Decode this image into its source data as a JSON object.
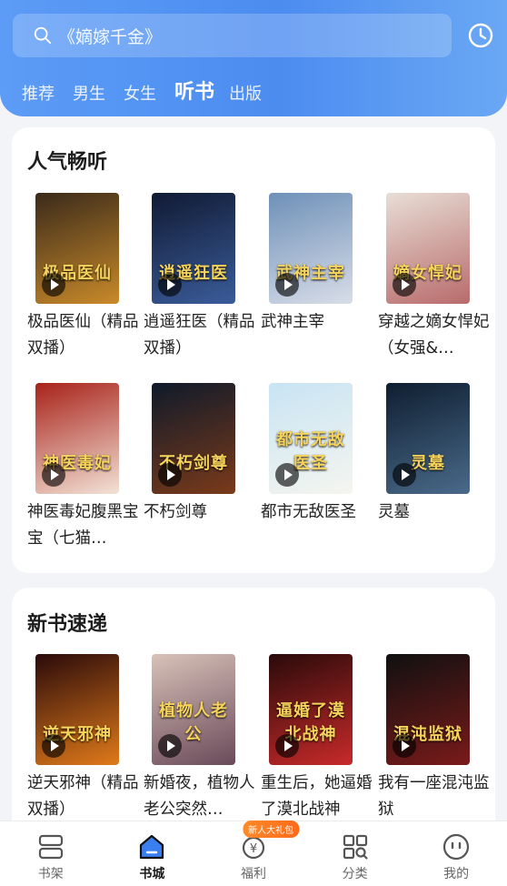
{
  "header": {
    "search_placeholder": "《嫡嫁千金》",
    "tabs": [
      {
        "label": "推荐",
        "active": false
      },
      {
        "label": "男生",
        "active": false
      },
      {
        "label": "女生",
        "active": false
      },
      {
        "label": "听书",
        "active": true
      },
      {
        "label": "出版",
        "active": false
      }
    ],
    "accent": "#4c8cf0"
  },
  "sections": [
    {
      "title": "人气畅听",
      "books": [
        {
          "title": "极品医仙（精品双播）",
          "cover_text": "极品医仙",
          "cover_colors": [
            "#3a2a1a",
            "#c98a2a"
          ]
        },
        {
          "title": "逍遥狂医（精品双播）",
          "cover_text": "逍遥狂医",
          "cover_colors": [
            "#101a33",
            "#3b5c9a"
          ]
        },
        {
          "title": "武神主宰",
          "cover_text": "武神主宰",
          "cover_colors": [
            "#6e90b8",
            "#d8dde8"
          ]
        },
        {
          "title": "穿越之嫡女悍妃（女强&…",
          "cover_text": "嫡女悍妃",
          "cover_colors": [
            "#e8ded6",
            "#b86b6b"
          ]
        },
        {
          "title": "神医毒妃腹黑宝宝（七猫…",
          "cover_text": "神医毒妃",
          "cover_colors": [
            "#a8221a",
            "#f3e2d6"
          ]
        },
        {
          "title": "不朽剑尊",
          "cover_text": "不朽剑尊",
          "cover_colors": [
            "#0f1a2a",
            "#7a3a1a"
          ]
        },
        {
          "title": "都市无敌医圣",
          "cover_text": "都市无敌医圣",
          "cover_colors": [
            "#c8e4f4",
            "#f5f5ef"
          ]
        },
        {
          "title": "灵墓",
          "cover_text": "灵墓",
          "cover_colors": [
            "#0e1e30",
            "#4a6a8a"
          ]
        }
      ]
    },
    {
      "title": "新书速递",
      "books": [
        {
          "title": "逆天邪神（精品双播）",
          "cover_text": "逆天邪神",
          "cover_colors": [
            "#2a0a0a",
            "#e07a1a"
          ]
        },
        {
          "title": "新婚夜，植物人老公突然…",
          "cover_text": "植物人老公",
          "cover_colors": [
            "#d8c2b8",
            "#6a4a5a"
          ]
        },
        {
          "title": "重生后，她逼婚了漠北战神",
          "cover_text": "逼婚了漠北战神",
          "cover_colors": [
            "#2a0a0a",
            "#c82a2a"
          ]
        },
        {
          "title": "我有一座混沌监狱",
          "cover_text": "混沌监狱",
          "cover_colors": [
            "#101010",
            "#7a1a1a"
          ]
        }
      ]
    }
  ],
  "bottom_nav": {
    "items": [
      {
        "label": "书架",
        "icon": "bookshelf-icon",
        "active": false
      },
      {
        "label": "书城",
        "icon": "bookstore-icon",
        "active": true
      },
      {
        "label": "福利",
        "icon": "coin-icon",
        "active": false,
        "badge": "新人大礼包"
      },
      {
        "label": "分类",
        "icon": "category-icon",
        "active": false
      },
      {
        "label": "我的",
        "icon": "profile-icon",
        "active": false
      }
    ]
  }
}
